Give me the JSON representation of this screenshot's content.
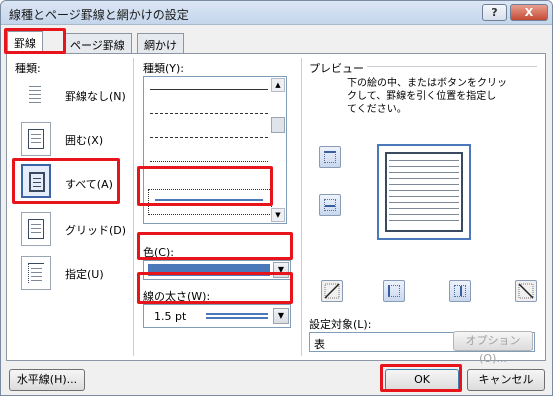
{
  "window": {
    "title": "線種とページ罫線と網かけの設定",
    "help_label": "?",
    "close_label": "X"
  },
  "tabs": [
    {
      "label": "罫線",
      "active": true
    },
    {
      "label": "ページ罫線",
      "active": false
    },
    {
      "label": "網かけ",
      "active": false
    }
  ],
  "settings": {
    "section_label": "種類:",
    "items": [
      {
        "label": "罫線なし(N)",
        "icon": "border-none-icon"
      },
      {
        "label": "囲む(X)",
        "icon": "border-box-icon"
      },
      {
        "label": "すべて(A)",
        "icon": "border-all-icon",
        "selected": true
      },
      {
        "label": "グリッド(D)",
        "icon": "border-grid-icon"
      },
      {
        "label": "指定(U)",
        "icon": "border-custom-icon"
      }
    ]
  },
  "style": {
    "section_label": "種類(Y):",
    "line_styles": [
      "solid",
      "dashed",
      "dash-dot",
      "dash-dot-dot",
      "double"
    ],
    "selected": "double",
    "color_label": "色(C):",
    "color_value": "#4a78b8",
    "width_label": "線の太さ(W):",
    "width_value": "1.5 pt"
  },
  "preview": {
    "section_label": "プレビュー",
    "instruction_line1": "下の絵の中、またはボタンをクリッ",
    "instruction_line2": "クして、罫線を引く位置を指定し",
    "instruction_line3": "てください。",
    "apply_to_label": "設定対象(L):",
    "apply_to_value": "表",
    "options_label": "オプション(O)..."
  },
  "footer": {
    "horizontal_line_label": "水平線(H)...",
    "ok_label": "OK",
    "cancel_label": "キャンセル"
  },
  "colors": {
    "highlight": "#e8141c",
    "line_color": "#4a78b8"
  }
}
